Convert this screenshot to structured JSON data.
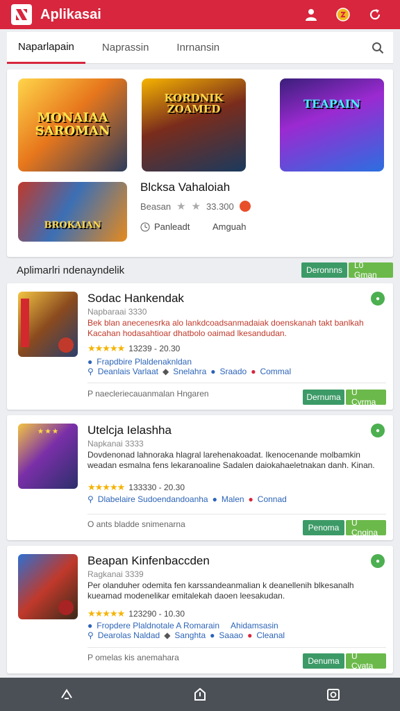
{
  "app": {
    "title": "Aplikasai"
  },
  "tabs": [
    {
      "label": "Naparlapain"
    },
    {
      "label": "Naprassin"
    },
    {
      "label": "Inrnansin"
    }
  ],
  "featured": {
    "art1": "MONAIAA SAROMAN",
    "art2": "KORDNIK ZOAMED",
    "art3": "TEAPAIN",
    "art4": "BROKAIAN",
    "title": "Blcksa Vahaloiah",
    "meta_label": "Beasan",
    "rating": "33.300",
    "action_primary": "Panleadt",
    "action_secondary": "Amguah"
  },
  "section": {
    "title": "Aplimarlri ndenayndelik",
    "btn_primary": "Deronnns",
    "btn_secondary": "L0 Gman"
  },
  "cards": [
    {
      "title": "Sodac Hankendak",
      "sub": "Napbaraai 3330",
      "desc": "Bek blan anecenesrka alo lankdcoadsanmadaiak doenskanah takt banlkah Kacahan hodasahtioar dhatbolo oaimad lkesandudan.",
      "rating": "13239 - 20.30",
      "link1": "Frapdbire Plaldenaknldan",
      "link2": "Deanlais Varlaat",
      "link3": "Snelahra",
      "link4": "Sraado",
      "link5": "Commal",
      "foot": "P naecleriecauanmalan Hngaren",
      "btn_primary": "Dernuma",
      "btn_secondary": "U Cyrma"
    },
    {
      "title": "Utelcja Ielashha",
      "sub": "Napkanai 3333",
      "desc": "Dovdenonad lahnoraka hlagral larehenakoadat. Ikenocenande molbamkin weadan esmalna fens lekaranoaline Sadalen daiokahaeletnakan danh. Kinan.",
      "rating": "133330 - 20.30",
      "link1": "Dlabelaire Sudoendandoanha",
      "link2": "Malen",
      "link3": "Connad",
      "foot": "O ants bladde snimenarna",
      "btn_primary": "Penoma",
      "btn_secondary": "U Cngina"
    },
    {
      "title": "Beapan Kinfenbaccden",
      "sub": "Ragkanai 3339",
      "desc": "Per olanduher odemita fen karssandeanmalian k deanellenih blkesanalh kueamad modenelikar emitalekah daoen leesakudan.",
      "rating": "123290 - 10.30",
      "link1": "Fropdere Plaldnotale A Romarain",
      "link2": "Ahidamsasin",
      "link3": "Dearolas Naldad",
      "link4": "Sanghta",
      "link5": "Saaao",
      "link6": "Cleanal",
      "foot": "P omelas kis anemahara",
      "btn_primary": "Denuma",
      "btn_secondary": "U Cyata"
    }
  ],
  "colors": {
    "accent": "#d7263d",
    "green_dark": "#3c9a67",
    "green_light": "#6cb94b",
    "link": "#2c64b8"
  }
}
